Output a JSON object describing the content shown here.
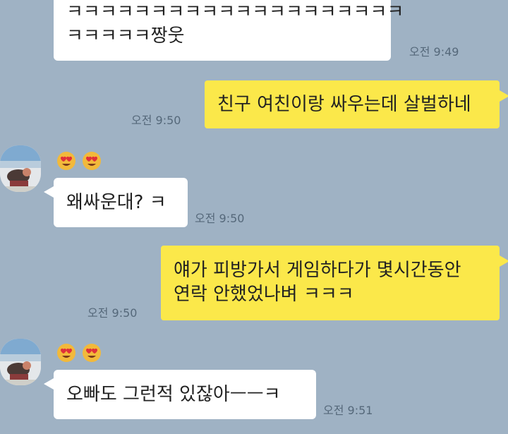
{
  "messages": [
    {
      "id": "m1",
      "direction": "incoming",
      "lines": [
        "ㅋㅋㅋㅋㅋㅋㅋㅋㅋㅋㅋㅋㅋㅋㅋㅋㅋㅋㅋㅋ",
        "ㅋㅋㅋㅋㅋ짱웃"
      ],
      "time": "오전 9:49"
    },
    {
      "id": "m2",
      "direction": "outgoing",
      "lines": [
        "친구 여친이랑 싸우는데 살벌하네"
      ],
      "time": "오전 9:50"
    },
    {
      "id": "m3",
      "direction": "incoming",
      "lines": [
        "왜싸운대? ㅋ"
      ],
      "time": "오전 9:50",
      "emoji_count": 2
    },
    {
      "id": "m4",
      "direction": "outgoing",
      "lines": [
        "얘가 피방가서 게임하다가 몇시간동안",
        "연락 안했었나벼 ㅋㅋㅋ"
      ],
      "time": "오전 9:50"
    },
    {
      "id": "m5",
      "direction": "incoming",
      "lines": [
        "오빠도 그런적 있잖아ㅡㅡㅋ"
      ],
      "time": "오전 9:51",
      "emoji_count": 2
    }
  ],
  "colors": {
    "background": "#9fb2c4",
    "incoming_bubble": "#ffffff",
    "outgoing_bubble": "#fbe84a",
    "time_text": "#55687a"
  },
  "icons": {
    "sender_emoji": "heart-eyes-emoji",
    "avatar": "profile-photo"
  }
}
